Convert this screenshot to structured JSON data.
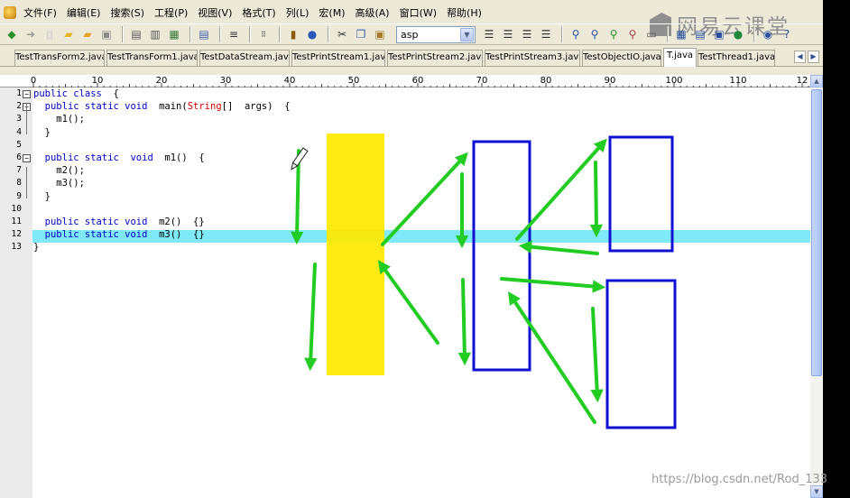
{
  "menu": [
    "文件(F)",
    "编辑(E)",
    "搜索(S)",
    "工程(P)",
    "视图(V)",
    "格式(T)",
    "列(L)",
    "宏(M)",
    "高级(A)",
    "窗口(W)",
    "帮助(H)"
  ],
  "logo_text": "网易云课堂",
  "toolbar": {
    "font_value": "asp"
  },
  "tabs": [
    "TestTransForm2.java",
    "TestTransForm1.java",
    "TestDataStream.java",
    "TestPrintStream1.java",
    "TestPrintStream2.java",
    "TestPrintStream3.java",
    "TestObjectIO.java",
    "T.java",
    "TestThread1.java"
  ],
  "active_tab": "T.java",
  "ruler_labels": [
    "0",
    "10",
    "20",
    "30",
    "40",
    "50",
    "60",
    "70",
    "80",
    "90",
    "100",
    "110",
    "12"
  ],
  "line_numbers": [
    "1",
    "2",
    "3",
    "4",
    "5",
    "6",
    "7",
    "8",
    "9",
    "10",
    "11",
    "12",
    "13"
  ],
  "code_lines": [
    [
      [
        "kw",
        "public class"
      ],
      [
        "",
        "  {"
      ]
    ],
    [
      [
        "",
        "  "
      ],
      [
        "kw",
        "public static void"
      ],
      [
        "",
        "  main("
      ],
      [
        "ty",
        "String"
      ],
      [
        "",
        "[]  args)  {"
      ]
    ],
    [
      [
        "",
        "    m1();"
      ]
    ],
    [
      [
        "",
        "  }"
      ]
    ],
    [
      [
        "",
        ""
      ]
    ],
    [
      [
        "",
        "  "
      ],
      [
        "kw",
        "public static  void"
      ],
      [
        "",
        "  m1()  {"
      ]
    ],
    [
      [
        "",
        "    m2();"
      ]
    ],
    [
      [
        "",
        "    m3();"
      ]
    ],
    [
      [
        "",
        "  }"
      ]
    ],
    [
      [
        "",
        ""
      ]
    ],
    [
      [
        "",
        "  "
      ],
      [
        "kw",
        "public static void"
      ],
      [
        "",
        "  m2()  {}"
      ]
    ],
    [
      [
        "",
        "  "
      ],
      [
        "kw",
        "public static void"
      ],
      [
        "",
        "  m3()  {}"
      ]
    ],
    [
      [
        "",
        "}"
      ]
    ]
  ],
  "colors": {
    "highlight": "#7fe9f7",
    "marker": "#ffe800",
    "arrow": "#22cc22",
    "box": "#1010d0",
    "keyword": "#0000c8",
    "type": "#d40000"
  },
  "watermark": "https://blog.csdn.net/Rod_133"
}
